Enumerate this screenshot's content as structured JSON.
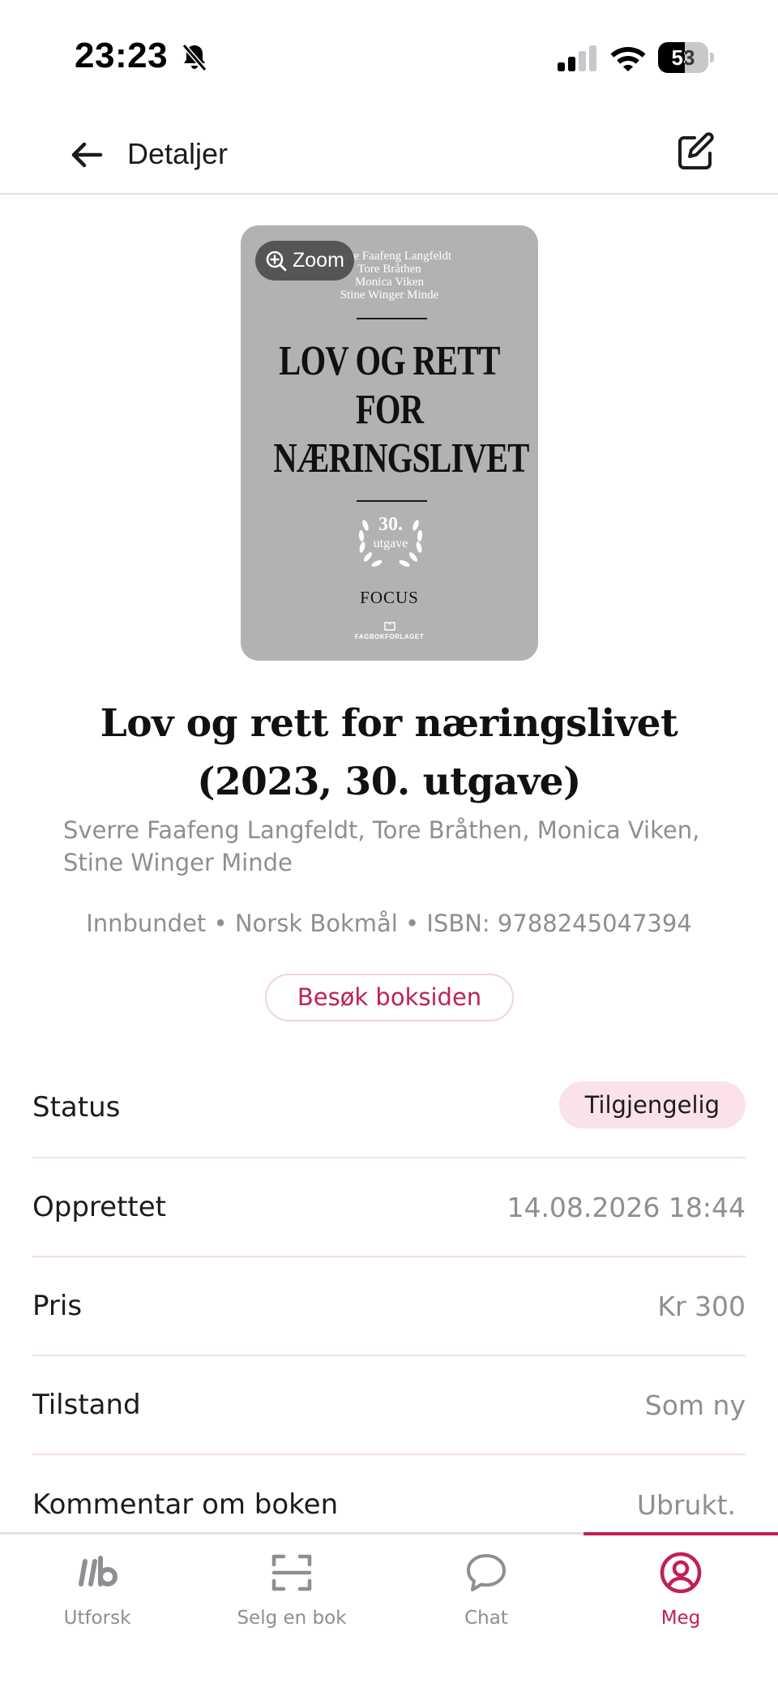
{
  "status_bar": {
    "time": "23:23",
    "battery_level": "53",
    "battery_fraction": 0.53,
    "icons": [
      "bell-muted-icon",
      "signal-icon",
      "wifi-icon",
      "battery-icon"
    ]
  },
  "header": {
    "title": "Detaljer",
    "back_icon": "arrow-left-icon",
    "edit_icon": "edit-icon"
  },
  "cover": {
    "authors": [
      "Sverre Faafeng Langfeldt",
      "Tore Bråthen",
      "Monica Viken",
      "Stine Winger Minde"
    ],
    "title_lines": [
      "LOV OG RETT",
      "FOR",
      "NÆRINGSLIVET"
    ],
    "edition_number": "30.",
    "edition_word": "utgave",
    "series": "FOCUS",
    "publisher": "FAGBOKFORLAGET",
    "zoom_label": "Zoom"
  },
  "book": {
    "title": "Lov og rett for næringslivet (2023, 30. utgave)",
    "authors": "Sverre Faafeng Langfeldt, Tore Bråthen, Monica Viken, Stine Winger Minde",
    "format_line": "Innbundet • Norsk Bokmål • ISBN: 9788245047394",
    "visit_button": "Besøk boksiden"
  },
  "details": {
    "status_label": "Status",
    "status_value": "Tilgjengelig",
    "created_label": "Opprettet",
    "created_value": "14.08.2026 18:44",
    "price_label": "Pris",
    "price_value": "Kr 300",
    "condition_label": "Tilstand",
    "condition_value": "Som ny",
    "comment_label": "Kommentar om boken",
    "comment_value": "Ubrukt."
  },
  "tabbar": {
    "tabs": [
      {
        "label": "Utforsk",
        "icon": "logo-ib-icon",
        "active": false
      },
      {
        "label": "Selg en bok",
        "icon": "scan-icon",
        "active": false
      },
      {
        "label": "Chat",
        "icon": "chat-bubble-icon",
        "active": false
      },
      {
        "label": "Meg",
        "icon": "user-circle-icon",
        "active": true
      }
    ]
  },
  "colors": {
    "accent": "#c0205a",
    "badge_bg": "#fbe1e8",
    "muted_text": "#8e8e93",
    "cover_bg": "#b2b2b2"
  }
}
